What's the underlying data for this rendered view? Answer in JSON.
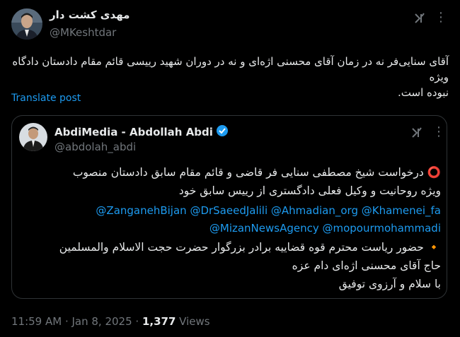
{
  "tweet": {
    "author_name": "مهدی کشت دار",
    "author_handle": "@MKeshtdar",
    "text_line1": "آقای سنایی‌فر نه در زمان آقای محسنی اژه‌ای و نه در دوران شهید رییسی قائم مقام دادستان دادگاه ویژه",
    "text_line2": "نبوده است.",
    "translate_label": "Translate post",
    "timestamp": "11:59 AM · Jan 8, 2025 · ",
    "views_count": "1,377",
    "views_label": " Views"
  },
  "quoted": {
    "author_name": "AbdiMedia - Abdollah Abdi",
    "author_handle": "@abdolah_abdi",
    "line1": "⭕ درخواست شیخ مصطفی سنایی فر قاضی و قائم مقام سابق دادستان منصوب",
    "line2": "ویژه روحانیت و وکیل فعلی دادگستری از رییس سابق خود",
    "mentions1": "@ZanganehBijan @DrSaeedJalili @Ahmadian_org @Khamenei_fa",
    "mentions2": "@MizanNewsAgency @mopourmohammadi",
    "line3": "🔸 حضور ریاست محترم قوه قضاییه برادر بزرگوار حضرت حجت الاسلام والمسلمین",
    "line4": "حاج آقای محسنی اژه‌ای دام عزه",
    "line5": "با سلام و آرزوی توفیق"
  },
  "icons": [
    "grok-icon",
    "more-icon",
    "verified-badge-icon"
  ],
  "colors": {
    "background": "#000000",
    "text": "#e7e9ea",
    "muted": "#71767b",
    "link": "#1d9bf0",
    "border": "#2f3336",
    "verified": "#1d9bf0"
  }
}
